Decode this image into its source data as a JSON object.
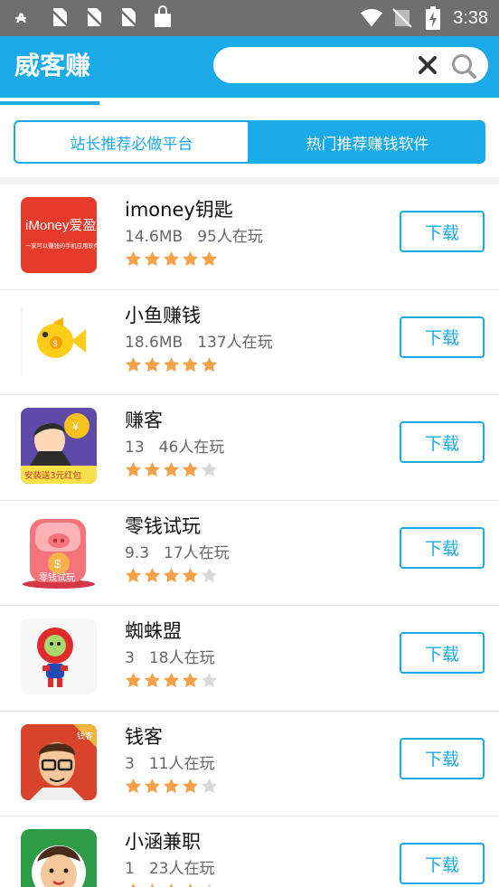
{
  "status_bar": {
    "time": "3:38",
    "icons": [
      "font-icon",
      "no-sim-icon",
      "no-sim-icon",
      "no-sim-icon",
      "shopping-bag-icon",
      "wifi-icon",
      "no-signal-icon",
      "battery-charging-icon"
    ]
  },
  "header": {
    "title": "威客赚",
    "search": {
      "placeholder": "",
      "value": ""
    }
  },
  "tabs": [
    {
      "label": "站长推荐必做平台",
      "active": false
    },
    {
      "label": "热门推荐赚钱软件",
      "active": true
    }
  ],
  "colors": {
    "accent": "#1aaae8",
    "star": "#f5a14a",
    "star_empty": "#d8d8d8"
  },
  "apps": [
    {
      "name": "imoney钥匙",
      "size": "14.6MB",
      "players": "95人在玩",
      "rating": 5,
      "download_label": "下载",
      "icon": "imoney-app-icon",
      "icon_text": "iMoney爱盈利",
      "icon_subtext": "一家可以赚钱的手机应用软件"
    },
    {
      "name": "小鱼赚钱",
      "size": "18.6MB",
      "players": "137人在玩",
      "rating": 5,
      "download_label": "下载",
      "icon": "yellow-fish-icon"
    },
    {
      "name": "赚客",
      "size": "13",
      "players": "46人在玩",
      "rating": 4,
      "download_label": "下载",
      "icon": "zhuanke-app-icon",
      "icon_text": "安装送3元红包"
    },
    {
      "name": "零钱试玩",
      "size": "9.3",
      "players": "17人在玩",
      "rating": 4,
      "download_label": "下载",
      "icon": "piggy-bank-icon",
      "icon_text": "零钱试玩"
    },
    {
      "name": "蜘蛛盟",
      "size": "3",
      "players": "18人在玩",
      "rating": 4,
      "download_label": "下载",
      "icon": "spiderman-character-icon"
    },
    {
      "name": "钱客",
      "size": "3",
      "players": "11人在玩",
      "rating": 4,
      "download_label": "下载",
      "icon": "qianke-man-icon",
      "icon_text": "钱客"
    },
    {
      "name": "小涵兼职",
      "size": "1",
      "players": "23人在玩",
      "rating": 4,
      "download_label": "下载",
      "icon": "cartoon-boy-icon"
    }
  ]
}
